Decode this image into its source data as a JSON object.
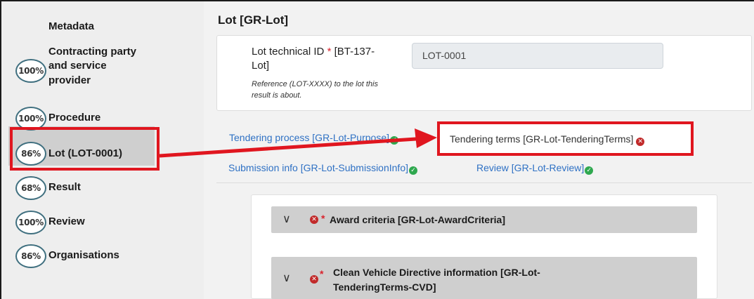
{
  "sidebar": {
    "items": [
      {
        "percent": "",
        "label": "Metadata"
      },
      {
        "percent": "100%",
        "label_lines": [
          "Contracting party",
          "and service",
          "provider"
        ]
      },
      {
        "percent": "100%",
        "label": "Procedure"
      },
      {
        "percent": "86%",
        "label": "Lot (LOT-0001)"
      },
      {
        "percent": "68%",
        "label": "Result"
      },
      {
        "percent": "100%",
        "label": "Review"
      },
      {
        "percent": "86%",
        "label": "Organisations"
      }
    ]
  },
  "main": {
    "title": "Lot [GR-Lot]",
    "field": {
      "label_part1": "Lot technical ID",
      "required_mark": "*",
      "label_part2": "[BT-137-",
      "label_part3": "Lot]",
      "hint_line1": "Reference (LOT-XXXX) to the lot this",
      "hint_line2": "result is about.",
      "value": "LOT-0001"
    },
    "tabs": {
      "tendering_process": "Tendering process  [GR-Lot-Purpose]",
      "tendering_terms": "Tendering terms  [GR-Lot-TenderingTerms]",
      "submission_info": "Submission info  [GR-Lot-SubmissionInfo]",
      "review": "Review  [GR-Lot-Review]"
    },
    "sections": {
      "award_criteria": "Award criteria  [GR-Lot-AwardCriteria]",
      "cvd_line1": "Clean Vehicle Directive information  [GR-Lot-",
      "cvd_line2": "TenderingTerms-CVD]"
    },
    "status_icons": {
      "ok": "check-circle",
      "error": "times-circle"
    }
  },
  "colors": {
    "highlight": "#e0161f",
    "link": "#2f71c4",
    "ok": "#2fa84f",
    "error": "#c12a2a",
    "badge_ring": "#3f6f7f"
  }
}
